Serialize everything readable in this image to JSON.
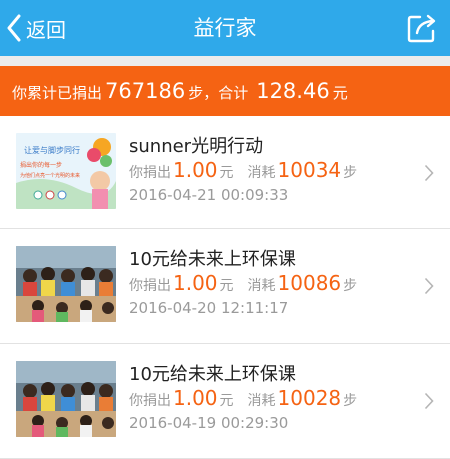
{
  "nav": {
    "back_label": "返回",
    "title": "益行家",
    "back_icon": "chevron-left-icon",
    "share_icon": "share-icon"
  },
  "summary": {
    "prefix": "你累计已捐出",
    "steps": "767186",
    "steps_unit": "步，合计",
    "amount": "128.46",
    "amount_unit": "元"
  },
  "labels": {
    "donate": "你捐出",
    "yuan": "元",
    "consume": "消耗",
    "steps": "步"
  },
  "donations": [
    {
      "title": "sunner光明行动",
      "amount": "1.00",
      "steps": "10034",
      "date": "2016-04-21 00:09:33",
      "thumb_text": [
        "让爱与脚步同行",
        "捐出你的每一步",
        "为他们点亮一个光明的未来"
      ]
    },
    {
      "title": "10元给未来上环保课",
      "amount": "1.00",
      "steps": "10086",
      "date": "2016-04-20 12:11:17"
    },
    {
      "title": "10元给未来上环保课",
      "amount": "1.00",
      "steps": "10028",
      "date": "2016-04-19 00:29:30"
    }
  ],
  "colors": {
    "nav": "#2fa9ea",
    "accent": "#f56313",
    "muted": "#9a9a9a"
  }
}
